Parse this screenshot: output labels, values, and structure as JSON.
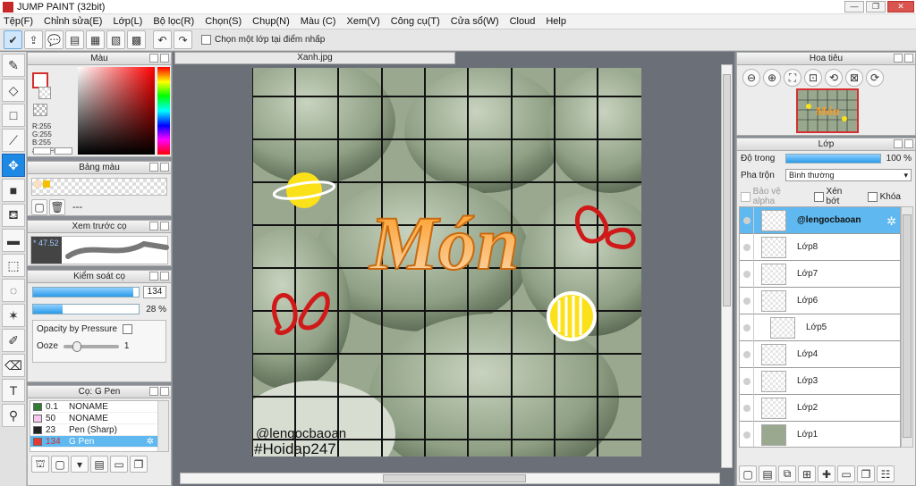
{
  "window": {
    "title": "JUMP PAINT (32bit)",
    "buttons": [
      "—",
      "❐",
      "✕"
    ]
  },
  "menu": [
    "Tệp(F)",
    "Chỉnh sửa(E)",
    "Lớp(L)",
    "Bộ lọc(R)",
    "Chọn(S)",
    "Chụp(N)",
    "Màu (C)",
    "Xem(V)",
    "Công cụ(T)",
    "Cửa sổ(W)",
    "Cloud",
    "Help"
  ],
  "toolbar": {
    "checkbox_label": "Chọn một lớp tại điểm nhấp"
  },
  "color_panel": {
    "title": "Màu",
    "rgb_lines": [
      "R:255",
      "G:255",
      "B:255",
      "#FFFFFF"
    ],
    "colors": {
      "fg": "#FFFFFF",
      "accent": "#D32F2F"
    }
  },
  "swatch_panel": {
    "title": "Bảng màu",
    "placeholder": "---"
  },
  "preview_panel": {
    "title": "Xem trước cọ",
    "value": "* 47.52"
  },
  "brush_control": {
    "title": "Kiểm soát cọ",
    "size": "134",
    "size_fill": 0.95,
    "opacity": "28 %",
    "opacity_fill": 0.28,
    "pressure_label": "Opacity by Pressure",
    "ooze_label": "Ooze",
    "ooze_value": "1"
  },
  "brush_list": {
    "title": "Cọ: G Pen",
    "items": [
      {
        "size": "0.1",
        "name": "NONAME",
        "color": "#2e7d32"
      },
      {
        "size": "50",
        "name": "NONAME",
        "color": "#f8c8f0"
      },
      {
        "size": "23",
        "name": "Pen (Sharp)",
        "color": "#222222"
      },
      {
        "size": "134",
        "name": "G Pen",
        "color": "#e53935"
      }
    ]
  },
  "canvas": {
    "tab": "Xanh.jpg",
    "title_art": "Món",
    "watermark_user": "@lengocbaoan",
    "watermark_tag": "#Hoidap247"
  },
  "navigator": {
    "title": "Hoa tiêu",
    "thumb_text": "Món"
  },
  "layers": {
    "title": "Lớp",
    "opacity_label": "Độ trong",
    "opacity_value": "100 %",
    "opacity_fill": 1.0,
    "blend_label": "Pha trộn",
    "blend_value": "Bình thường",
    "protect_alpha": "Bảo vệ alpha",
    "clip": "Xén bớt",
    "lock": "Khóa",
    "items": [
      {
        "name": "@lengocbaoan",
        "selected": true
      },
      {
        "name": "Lớp8"
      },
      {
        "name": "Lớp7"
      },
      {
        "name": "Lớp6"
      },
      {
        "name": "Lớp5"
      },
      {
        "name": "Lớp4"
      },
      {
        "name": "Lớp3"
      },
      {
        "name": "Lớp2"
      },
      {
        "name": "Lớp1"
      }
    ]
  }
}
